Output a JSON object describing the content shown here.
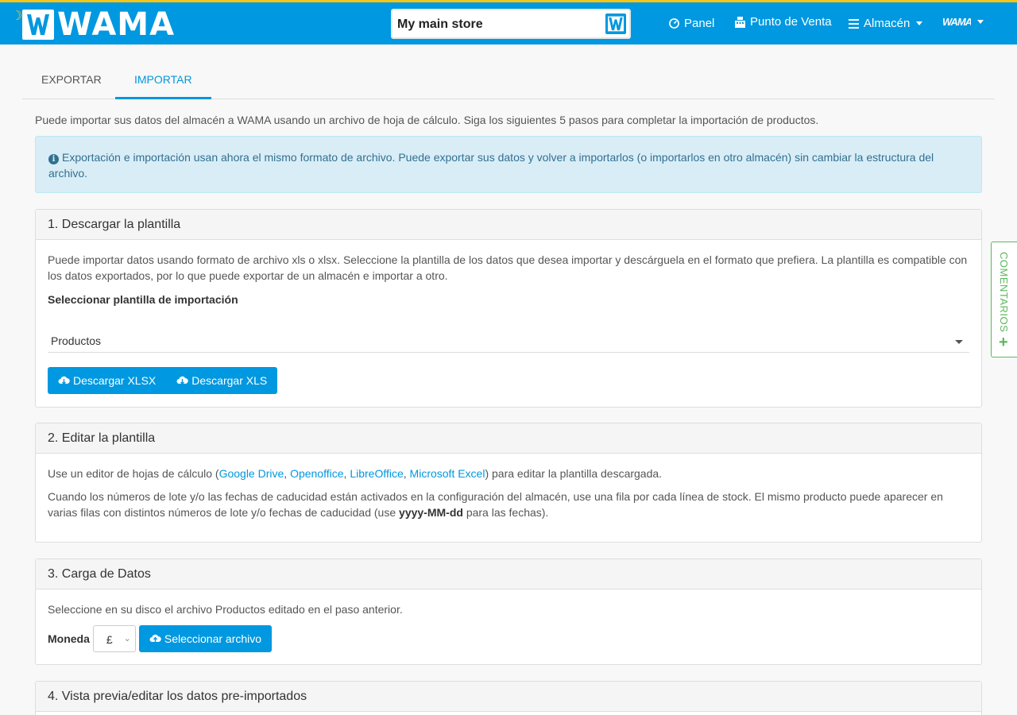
{
  "header": {
    "brand": "WAMA",
    "store_name": "My main store",
    "nav": {
      "panel": "Panel",
      "pos": "Punto de Venta",
      "warehouse": "Almacén",
      "account_logo": "WAMA"
    }
  },
  "tabs": [
    {
      "label": "EXPORTAR"
    },
    {
      "label": "IMPORTAR"
    }
  ],
  "intro": "Puede importar sus datos del almacén a WAMA usando un archivo de hoja de cálculo. Siga los siguientes 5 pasos para completar la importación de productos.",
  "alert": "Exportación e importación usan ahora el mismo formato de archivo. Puede exportar sus datos y volver a importarlos (o importarlos en otro almacén) sin cambiar la estructura del archivo.",
  "step1": {
    "title": "1. Descargar la plantilla",
    "text": "Puede importar datos usando formato de archivo xls o xlsx. Seleccione la plantilla de los datos que desea importar y descárguela en el formato que prefiera. La plantilla es compatible con los datos exportados, por lo que puede exportar de un almacén e importar a otro.",
    "select_label": "Seleccionar plantilla de importación",
    "selected_template": "Productos",
    "btn_xlsx": "Descargar XLSX",
    "btn_xls": "Descargar XLS"
  },
  "step2": {
    "title": "2. Editar la plantilla",
    "p1_before": "Use un editor de hojas de cálculo (",
    "links": [
      "Google Drive",
      "Openoffice",
      "LibreOffice",
      "Microsoft Excel"
    ],
    "p1_after": ") para editar la plantilla descargada.",
    "p2_before": "Cuando los números de lote y/o las fechas de caducidad están activados en la configuración del almacén, use una fila por cada línea de stock. El mismo producto puede aparecer en varias filas con distintos números de lote y/o fechas de caducidad (use ",
    "p2_format": "yyyy-MM-dd",
    "p2_after": " para las fechas)."
  },
  "step3": {
    "title": "3. Carga de Datos",
    "text": "Seleccione en su disco el archivo Productos editado en el paso anterior.",
    "currency_label": "Moneda",
    "currency_value": "£",
    "btn_select": "Seleccionar archivo"
  },
  "step4": {
    "title": "4. Vista previa/editar los datos pre-importados"
  },
  "feedback_tab": "COMENTARIOS"
}
